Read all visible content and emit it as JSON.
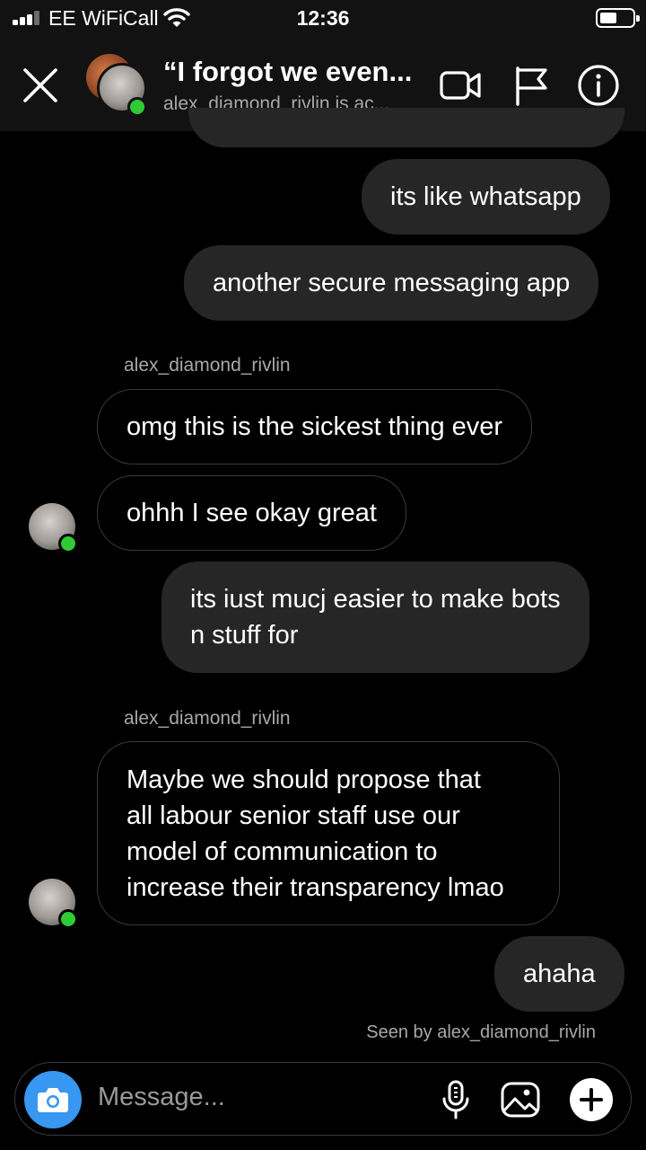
{
  "status": {
    "carrier": "EE WiFiCall",
    "time": "12:36"
  },
  "header": {
    "title": "“I forgot we even...",
    "subtitle": "alex_diamond_rivlin is ac...",
    "icons": [
      "close-icon",
      "video-call-icon",
      "flag-icon",
      "info-icon"
    ]
  },
  "messages": {
    "m1": "its like whatsapp",
    "m2": "another secure messaging app",
    "sender1": "alex_diamond_rivlin",
    "m3": "omg this is the sickest thing ever",
    "m4": "ohhh I see okay great",
    "m5_line1": "its iust mucj easier to make bots",
    "m5_line2": "n stuff for",
    "sender2": "alex_diamond_rivlin",
    "m6_line1": "Maybe we should propose that",
    "m6_line2": "all labour senior staff use our",
    "m6_line3": "model of communication to",
    "m6_line4": "increase their transparency lmao",
    "m7": "ahaha",
    "seen": "Seen by alex_diamond_rivlin"
  },
  "composer": {
    "placeholder": "Message...",
    "icons": [
      "camera-icon",
      "microphone-icon",
      "gallery-icon",
      "plus-icon"
    ]
  },
  "colors": {
    "accent": "#3897f0",
    "online": "#2fcb34",
    "bubble_out": "#262626"
  }
}
